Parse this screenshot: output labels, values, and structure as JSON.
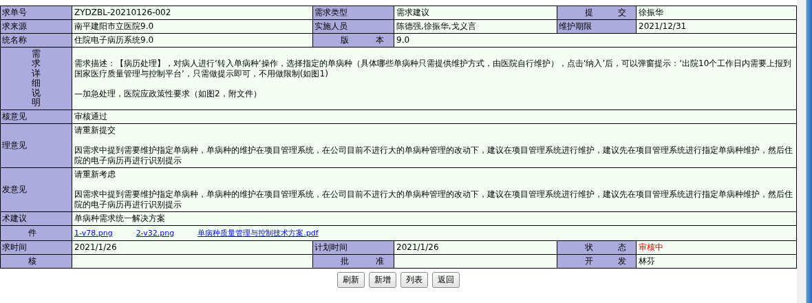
{
  "rows": [
    {
      "cells": [
        {
          "kind": "label",
          "text": "求单号"
        },
        {
          "kind": "value",
          "text": "ZYDZBL-20210126-002"
        },
        {
          "kind": "label",
          "text": "需求类型"
        },
        {
          "kind": "value",
          "text": "需求建议"
        },
        {
          "kind": "label",
          "text": "提 交",
          "spread": true
        },
        {
          "kind": "value",
          "text": "徐振华"
        }
      ]
    },
    {
      "cells": [
        {
          "kind": "label",
          "text": "求来源"
        },
        {
          "kind": "value",
          "text": "南平建阳市立医院9.0"
        },
        {
          "kind": "label",
          "text": "实施人员"
        },
        {
          "kind": "value",
          "text": "陈德强,徐振华,戈义言"
        },
        {
          "kind": "label",
          "text": "维护期限"
        },
        {
          "kind": "value",
          "text": "2021/12/31"
        }
      ]
    },
    {
      "cells": [
        {
          "kind": "label",
          "text": "统名称"
        },
        {
          "kind": "value",
          "text": "住院电子病历系统9.0"
        },
        {
          "kind": "label",
          "text": "版 本",
          "spread": true
        },
        {
          "kind": "value",
          "text": "9.0"
        }
      ]
    },
    {
      "cells": [
        {
          "kind": "vertical_label",
          "text": "需求详细说明"
        },
        {
          "kind": "value",
          "paragraphs": [
            "需求描述：【病历处理】，对病人进行‘转入单病种’操作，选择指定的单病种（具体哪些单病种只需提供维护方式，由医院自行维护），点击‘纳入’后，可以弹窗提示：‘出院10个工作日内需要上报到国家医疗质量管理与控制平台’，只需做提示即可，不用做限制(如图1)",
            "—加急处理，医院应政策性要求（如图2，附文件）"
          ]
        }
      ]
    },
    {
      "cells": [
        {
          "kind": "label",
          "text": "核意见"
        },
        {
          "kind": "value",
          "text": "审核通过"
        }
      ]
    },
    {
      "cells": [
        {
          "kind": "label",
          "text": "理意见"
        },
        {
          "kind": "value",
          "paragraphs": [
            "请重新提交",
            "因需求中提到需要维护指定单病种，单病种的维护在项目管理系统，在公司目前不进行大的单病种管理的改动下，建议在项目管理系统进行维护，建议先在项目管理系统进行指定单病种维护，然后住院的电子病历再进行识别提示"
          ]
        }
      ]
    },
    {
      "cells": [
        {
          "kind": "label",
          "text": "发意见"
        },
        {
          "kind": "value",
          "paragraphs": [
            "请重新考虑",
            "因需求中提到需要维护指定单病种，单病种的维护在项目管理系统，在公司目前不进行大的单病种管理的改动下，建议在项目管理系统进行维护，建议先在项目管理系统进行指定单病种维护，然后住院的电子病历再进行识别提示"
          ]
        }
      ]
    },
    {
      "cells": [
        {
          "kind": "label",
          "text": "术建议"
        },
        {
          "kind": "value",
          "text": "单病种需求统一解决方案"
        }
      ]
    },
    {
      "cells": [
        {
          "kind": "label",
          "text": "件",
          "spread": true
        },
        {
          "kind": "links",
          "links": [
            "1-v78.png",
            "2-v32.png",
            "单病种质量管理与控制技术方案.pdf"
          ]
        }
      ]
    },
    {
      "cells": [
        {
          "kind": "label",
          "text": "求时间"
        },
        {
          "kind": "value",
          "text": "2021/1/26"
        },
        {
          "kind": "label",
          "text": "计划时间"
        },
        {
          "kind": "value",
          "text": "2021/1/26"
        },
        {
          "kind": "label",
          "text": "状 态",
          "spread": true
        },
        {
          "kind": "value",
          "text": "审核中",
          "highlighted": true
        }
      ]
    },
    {
      "cells": [
        {
          "kind": "label",
          "text": "核",
          "spread": true
        },
        {
          "kind": "value"
        },
        {
          "kind": "label",
          "text": "批 准",
          "spread": true
        },
        {
          "kind": "value"
        },
        {
          "kind": "label",
          "text": "开 发",
          "spread": true
        },
        {
          "kind": "value",
          "text": "林芬"
        }
      ]
    }
  ],
  "buttons": [
    "刷新",
    "新增",
    "列表",
    "返回"
  ]
}
